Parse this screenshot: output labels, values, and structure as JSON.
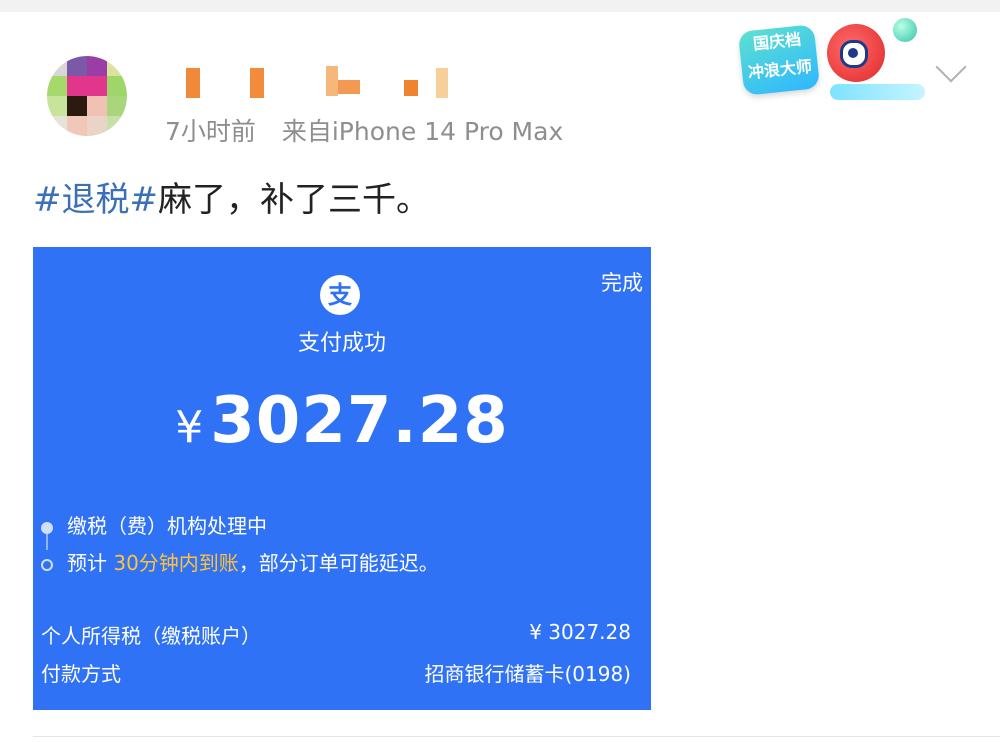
{
  "post": {
    "meta_time": "7小时前",
    "meta_source": "来自iPhone 14 Pro Max",
    "hashtag": "#退税#",
    "text": "麻了，补了三千。"
  },
  "badge": {
    "line1": "国庆档",
    "line2": "冲浪大师"
  },
  "icons": [
    "avatar",
    "badge-mascot-icon",
    "chevron-down-icon",
    "alipay-logo-icon"
  ],
  "payment": {
    "done_label": "完成",
    "logo_glyph": "支",
    "status": "支付成功",
    "currency_symbol": "¥",
    "amount": "3027.28",
    "step1": "缴税（费）机构处理中",
    "step2_prefix": "预计 ",
    "step2_highlight": "30分钟内到账",
    "step2_suffix": "，部分订单可能延迟。",
    "item_label": "个人所得税（缴税账户）",
    "item_value": "¥ 3027.28",
    "method_label": "付款方式",
    "method_value": "招商银行储蓄卡(0198)",
    "colors": {
      "background": "#2f72f5",
      "highlight": "#ffc23a"
    }
  }
}
